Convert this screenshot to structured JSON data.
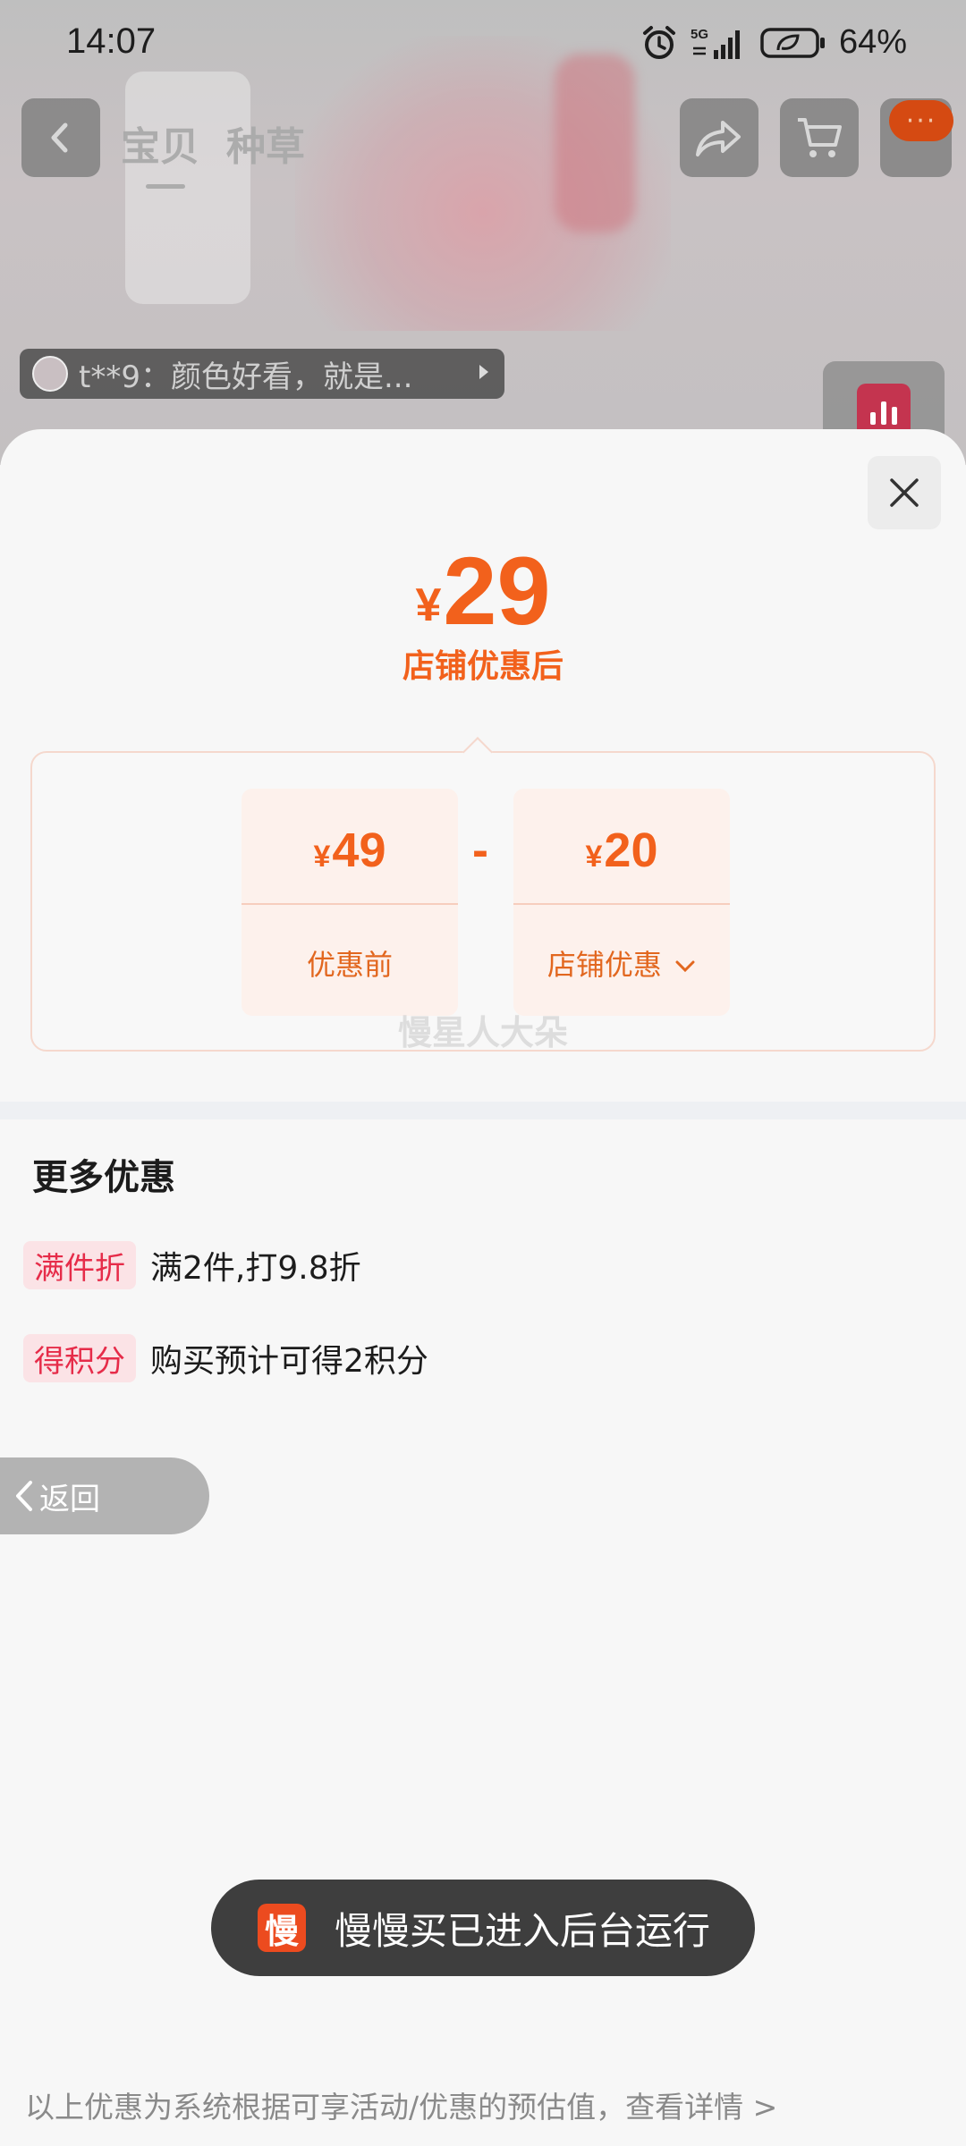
{
  "status_bar": {
    "time": "14:07",
    "network": "5G",
    "battery_percent": "64%",
    "icons": [
      "alarm-icon",
      "signal-5g-icon",
      "battery-eco-icon"
    ]
  },
  "nav": {
    "tabs": [
      {
        "label": "宝贝",
        "active": true
      },
      {
        "label": "种草",
        "active": false
      }
    ],
    "more_label": "···",
    "icons": [
      "back-icon",
      "share-icon",
      "cart-icon",
      "more-icon"
    ]
  },
  "comment": {
    "text": "t**9：颜色好看，就是..."
  },
  "price_sheet": {
    "currency": "¥",
    "final_price": "29",
    "final_caption": "店铺优惠后",
    "original": {
      "currency": "¥",
      "value": "49",
      "label": "优惠前"
    },
    "operator": "-",
    "discount": {
      "currency": "¥",
      "value": "20",
      "label": "店铺优惠"
    },
    "watermark": "慢星人大朵"
  },
  "more_offers": {
    "title": "更多优惠",
    "items": [
      {
        "tag": "满件折",
        "desc": "满2件,打9.8折"
      },
      {
        "tag": "得积分",
        "desc": "购买预计可得2积分"
      }
    ]
  },
  "back_pill": {
    "label": "返回"
  },
  "toast": {
    "logo_char": "慢",
    "text": "慢慢买已进入后台运行"
  },
  "footer": {
    "note": "以上优惠为系统根据可享活动/优惠的预估值，查看详情 >"
  },
  "colors": {
    "accent": "#f2611c",
    "tag_red": "#e62c49",
    "tag_bg": "#fbe3e6",
    "toast_bg": "#3e3e3e",
    "toast_logo": "#ec4b1f"
  }
}
